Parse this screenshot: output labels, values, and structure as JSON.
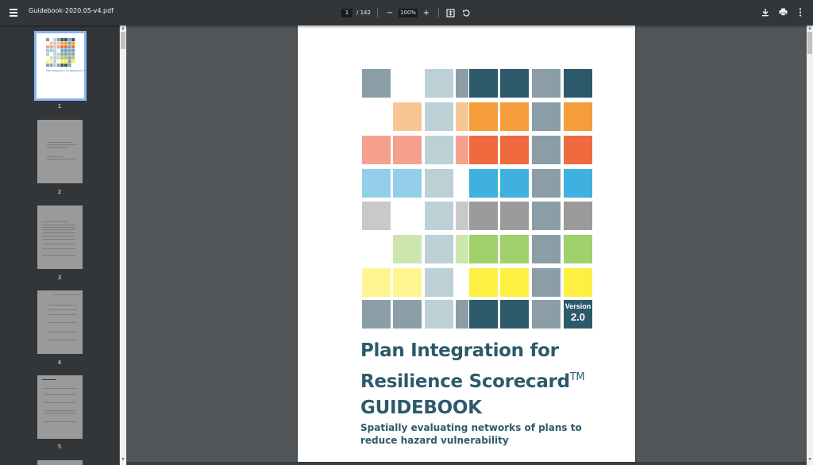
{
  "toolbar": {
    "filename": "Guidebook-2020.05-v4.pdf",
    "current_page": "1",
    "total_pages": "/ 142",
    "zoom": "100%",
    "zoom_out": "−",
    "zoom_in": "+"
  },
  "sidebar": {
    "thumbnails": [
      {
        "number": "1",
        "active": true
      },
      {
        "number": "2",
        "active": false
      },
      {
        "number": "3",
        "active": false
      },
      {
        "number": "4",
        "active": false
      },
      {
        "number": "5",
        "active": false
      }
    ],
    "thumb1_title": "Plan Integration for Resilience Scorecard™ GUIDEBOOK",
    "thumb3_heading": "TABLE OF CONTENTS"
  },
  "document": {
    "version_label": "Version",
    "version_number": "2.0",
    "title_line1": "Plan Integration for",
    "title_line2": "Resilience Scorecard",
    "title_tm": "TM",
    "title_line3": "GUIDEBOOK",
    "subtitle_line1": "Spatially evaluating networks of plans to",
    "subtitle_line2": "reduce hazard vulnerability"
  },
  "colors": {
    "teal_dark": "#2d5a6b",
    "slate": "#8b9ea8",
    "pale_blue": "#bcd0d6",
    "orange": "#f59d3a",
    "orange_light": "#f7c694",
    "red": "#f06a3f",
    "red_light": "#f5a08f",
    "blue": "#3eb1e0",
    "blue_light": "#93cfea",
    "gray": "#9b9b9b",
    "gray_light": "#c9c9c9",
    "green": "#9fd06a",
    "green_light": "#cde6ae",
    "yellow": "#fdf040",
    "yellow_light": "#fdf590"
  },
  "icons": {
    "menu": "hamburger-icon",
    "fit": "fit-to-page-icon",
    "rotate": "rotate-icon",
    "download": "download-icon",
    "print": "print-icon",
    "more": "more-vert-icon"
  }
}
